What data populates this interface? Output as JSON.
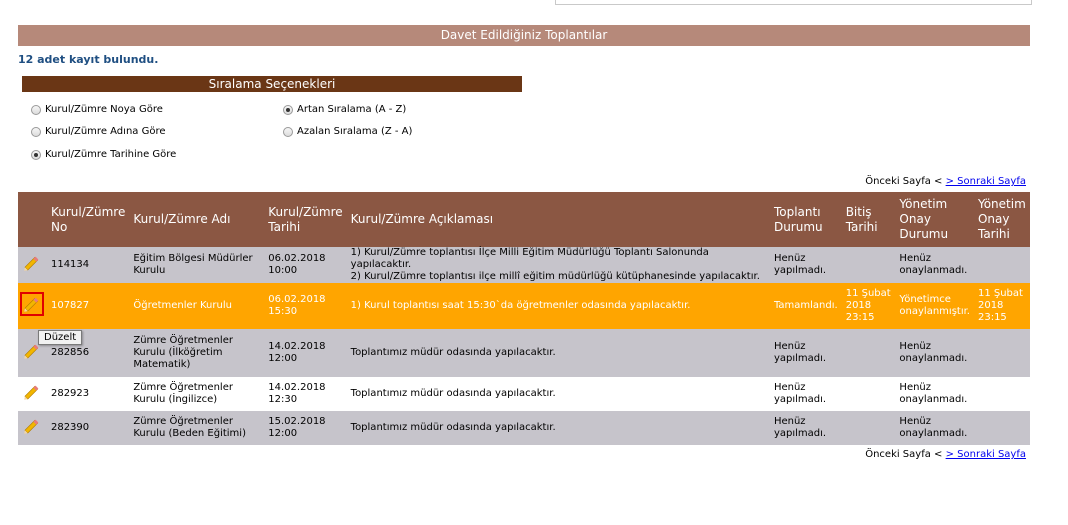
{
  "title": "Davet Edildiğiniz Toplantılar",
  "record_count": "12 adet kayıt bulundu.",
  "sort": {
    "header": "Sıralama Seçenekleri",
    "options": [
      "Kurul/Zümre Noya Göre",
      "Kurul/Zümre Adına Göre",
      "Kurul/Zümre Tarihine Göre"
    ],
    "selected_option": 2,
    "orders": [
      "Artan Sıralama (A - Z)",
      "Azalan Sıralama (Z - A)"
    ],
    "selected_order": 0
  },
  "pager": {
    "prev": "Önceki Sayfa <",
    "next": " > Sonraki Sayfa"
  },
  "columns": [
    {
      "label": "Kurul/Zümre No"
    },
    {
      "label": "Kurul/Zümre Adı"
    },
    {
      "label": "Kurul/Zümre Tarihi"
    },
    {
      "label": "Kurul/Zümre Açıklaması"
    },
    {
      "label": "Toplantı Durumu"
    },
    {
      "label": "Bitiş Tarihi"
    },
    {
      "label": "Yönetim Onay Durumu"
    },
    {
      "label": "Yönetim Onay Tarihi"
    }
  ],
  "rows": [
    {
      "no": "114134",
      "name": "Eğitim Bölgesi Müdürler Kurulu",
      "date": "06.02.2018",
      "time": "10:00",
      "desc": "1) Kurul/Zümre toplantısı İlçe Milli Eğitim Müdürlüğü Toplantı Salonunda yapılacaktır.",
      "desc2": "2) Kurul/Zümre toplantısı ilçe millî eğitim müdürlüğü kütüphanesinde yapılacaktır.",
      "status": "Henüz yapılmadı.",
      "end": "",
      "approval": "Henüz onaylanmadı.",
      "approval_date": ""
    },
    {
      "no": "107827",
      "name": "Öğretmenler Kurulu",
      "date": "06.02.2018",
      "time": "15:30",
      "desc": "1) Kurul toplantısı saat 15:30`da öğretmenler odasında yapılacaktır.",
      "desc2": "",
      "status": "Tamamlandı.",
      "end": "11 Şubat 2018 23:15",
      "approval": "Yönetimce onaylanmıştır.",
      "approval_date": "11 Şubat 2018 23:15"
    },
    {
      "no": "282856",
      "name": "Zümre Öğretmenler Kurulu (İlköğretim Matematik)",
      "date": "14.02.2018",
      "time": "12:00",
      "desc": "Toplantımız müdür odasında yapılacaktır.",
      "desc2": "",
      "status": "Henüz yapılmadı.",
      "end": "",
      "approval": "Henüz onaylanmadı.",
      "approval_date": ""
    },
    {
      "no": "282923",
      "name": "Zümre Öğretmenler Kurulu (İngilizce)",
      "date": "14.02.2018",
      "time": "12:30",
      "desc": "Toplantımız müdür odasında yapılacaktır.",
      "desc2": "",
      "status": "Henüz yapılmadı.",
      "end": "",
      "approval": "Henüz onaylanmadı.",
      "approval_date": ""
    },
    {
      "no": "282390",
      "name": "Zümre Öğretmenler Kurulu (Beden Eğitimi)",
      "date": "15.02.2018",
      "time": "12:00",
      "desc": "Toplantımız müdür odasında yapılacaktır.",
      "desc2": "",
      "status": "Henüz yapılmadı.",
      "end": "",
      "approval": "Henüz onaylanmadı.",
      "approval_date": ""
    }
  ],
  "tooltip": "Düzelt",
  "colors": {
    "title_bar": "#b6897a",
    "sort_bar": "#6a3615",
    "header": "#8b5743",
    "row_gray": "#c6c4cb",
    "row_selected": "#ffa500",
    "count_text": "#1f4f82"
  }
}
